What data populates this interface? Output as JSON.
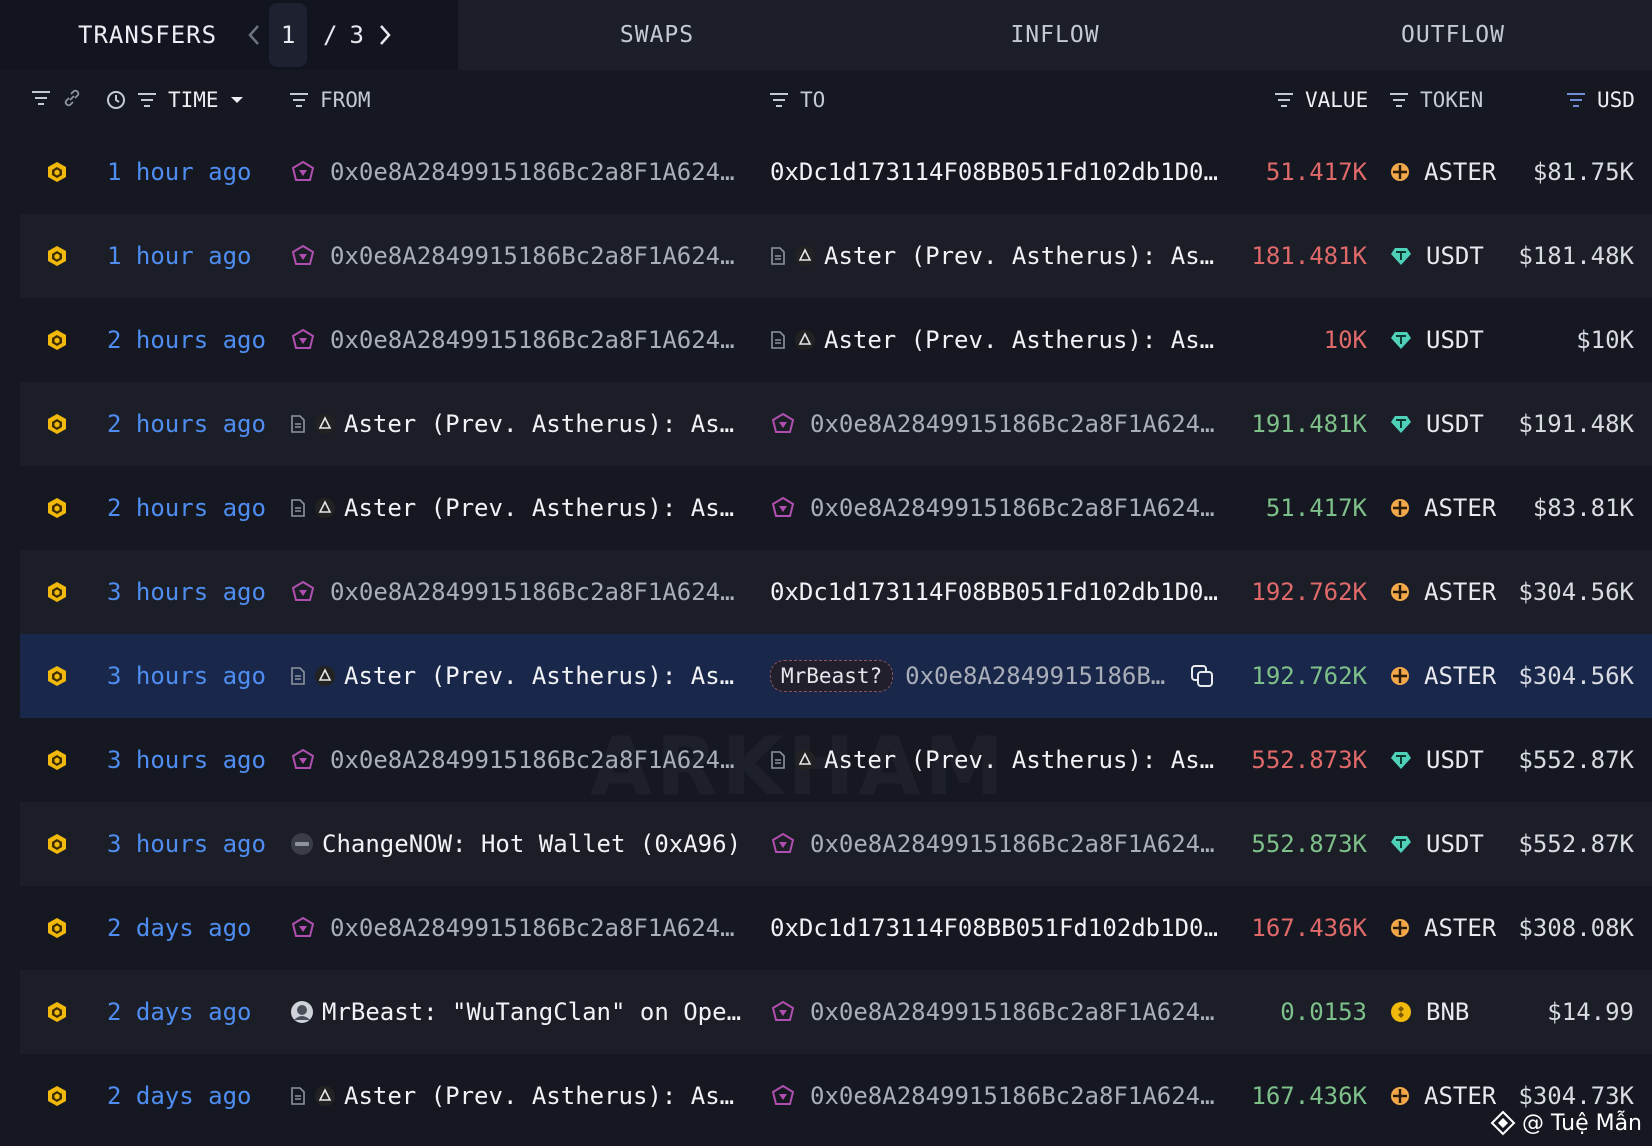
{
  "tabs": {
    "transfers": "TRANSFERS",
    "page_current": "1",
    "page_sep": "/",
    "page_total": "3",
    "swaps": "SWAPS",
    "inflow": "INFLOW",
    "outflow": "OUTFLOW"
  },
  "columns": {
    "time": "TIME",
    "from": "FROM",
    "to": "TO",
    "value": "VALUE",
    "token": "TOKEN",
    "usd": "USD"
  },
  "rows": [
    {
      "time": "1 hour ago",
      "from": "0x0e8A2849915186Bc2a8F1A624…",
      "to": "0xDc1d173114F08BB051Fd102db1D0…",
      "value": "51.417K",
      "token": "ASTER",
      "usd": "$81.75K"
    },
    {
      "time": "1 hour ago",
      "from": "0x0e8A2849915186Bc2a8F1A624…",
      "to": "Aster (Prev. Astherus): As…",
      "value": "181.481K",
      "token": "USDT",
      "usd": "$181.48K"
    },
    {
      "time": "2 hours ago",
      "from": "0x0e8A2849915186Bc2a8F1A624…",
      "to": "Aster (Prev. Astherus): As…",
      "value": "10K",
      "token": "USDT",
      "usd": "$10K"
    },
    {
      "time": "2 hours ago",
      "from": "Aster (Prev. Astherus): As…",
      "to": "0x0e8A2849915186Bc2a8F1A624…",
      "value": "191.481K",
      "token": "USDT",
      "usd": "$191.48K"
    },
    {
      "time": "2 hours ago",
      "from": "Aster (Prev. Astherus): As…",
      "to": "0x0e8A2849915186Bc2a8F1A624…",
      "value": "51.417K",
      "token": "ASTER",
      "usd": "$83.81K"
    },
    {
      "time": "3 hours ago",
      "from": "0x0e8A2849915186Bc2a8F1A624…",
      "to": "0xDc1d173114F08BB051Fd102db1D0…",
      "value": "192.762K",
      "token": "ASTER",
      "usd": "$304.56K"
    },
    {
      "time": "3 hours ago",
      "from": "Aster (Prev. Astherus): As…",
      "to_tag": "MrBeast?",
      "to": "0x0e8A2849915186B…",
      "value": "192.762K",
      "token": "ASTER",
      "usd": "$304.56K"
    },
    {
      "time": "3 hours ago",
      "from": "0x0e8A2849915186Bc2a8F1A624…",
      "to": "Aster (Prev. Astherus): As…",
      "value": "552.873K",
      "token": "USDT",
      "usd": "$552.87K"
    },
    {
      "time": "3 hours ago",
      "from": "ChangeNOW: Hot Wallet (0xA96)",
      "to": "0x0e8A2849915186Bc2a8F1A624…",
      "value": "552.873K",
      "token": "USDT",
      "usd": "$552.87K"
    },
    {
      "time": "2 days ago",
      "from": "0x0e8A2849915186Bc2a8F1A624…",
      "to": "0xDc1d173114F08BB051Fd102db1D0…",
      "value": "167.436K",
      "token": "ASTER",
      "usd": "$308.08K"
    },
    {
      "time": "2 days ago",
      "from": "MrBeast: \"WuTangClan\" on Ope…",
      "to": "0x0e8A2849915186Bc2a8F1A624…",
      "value": "0.0153",
      "token": "BNB",
      "usd": "$14.99"
    },
    {
      "time": "2 days ago",
      "from": "Aster (Prev. Astherus): As…",
      "to": "0x0e8A2849915186Bc2a8F1A624…",
      "value": "167.436K",
      "token": "ASTER",
      "usd": "$304.73K"
    }
  ],
  "watermark": "ARKHAM",
  "credit": "@ Tuệ Mẫn",
  "colors": {
    "outflow_value": "#e0696a",
    "inflow_value": "#7ec08a",
    "time_link": "#4f8df1",
    "selected_row": "#19284a"
  }
}
